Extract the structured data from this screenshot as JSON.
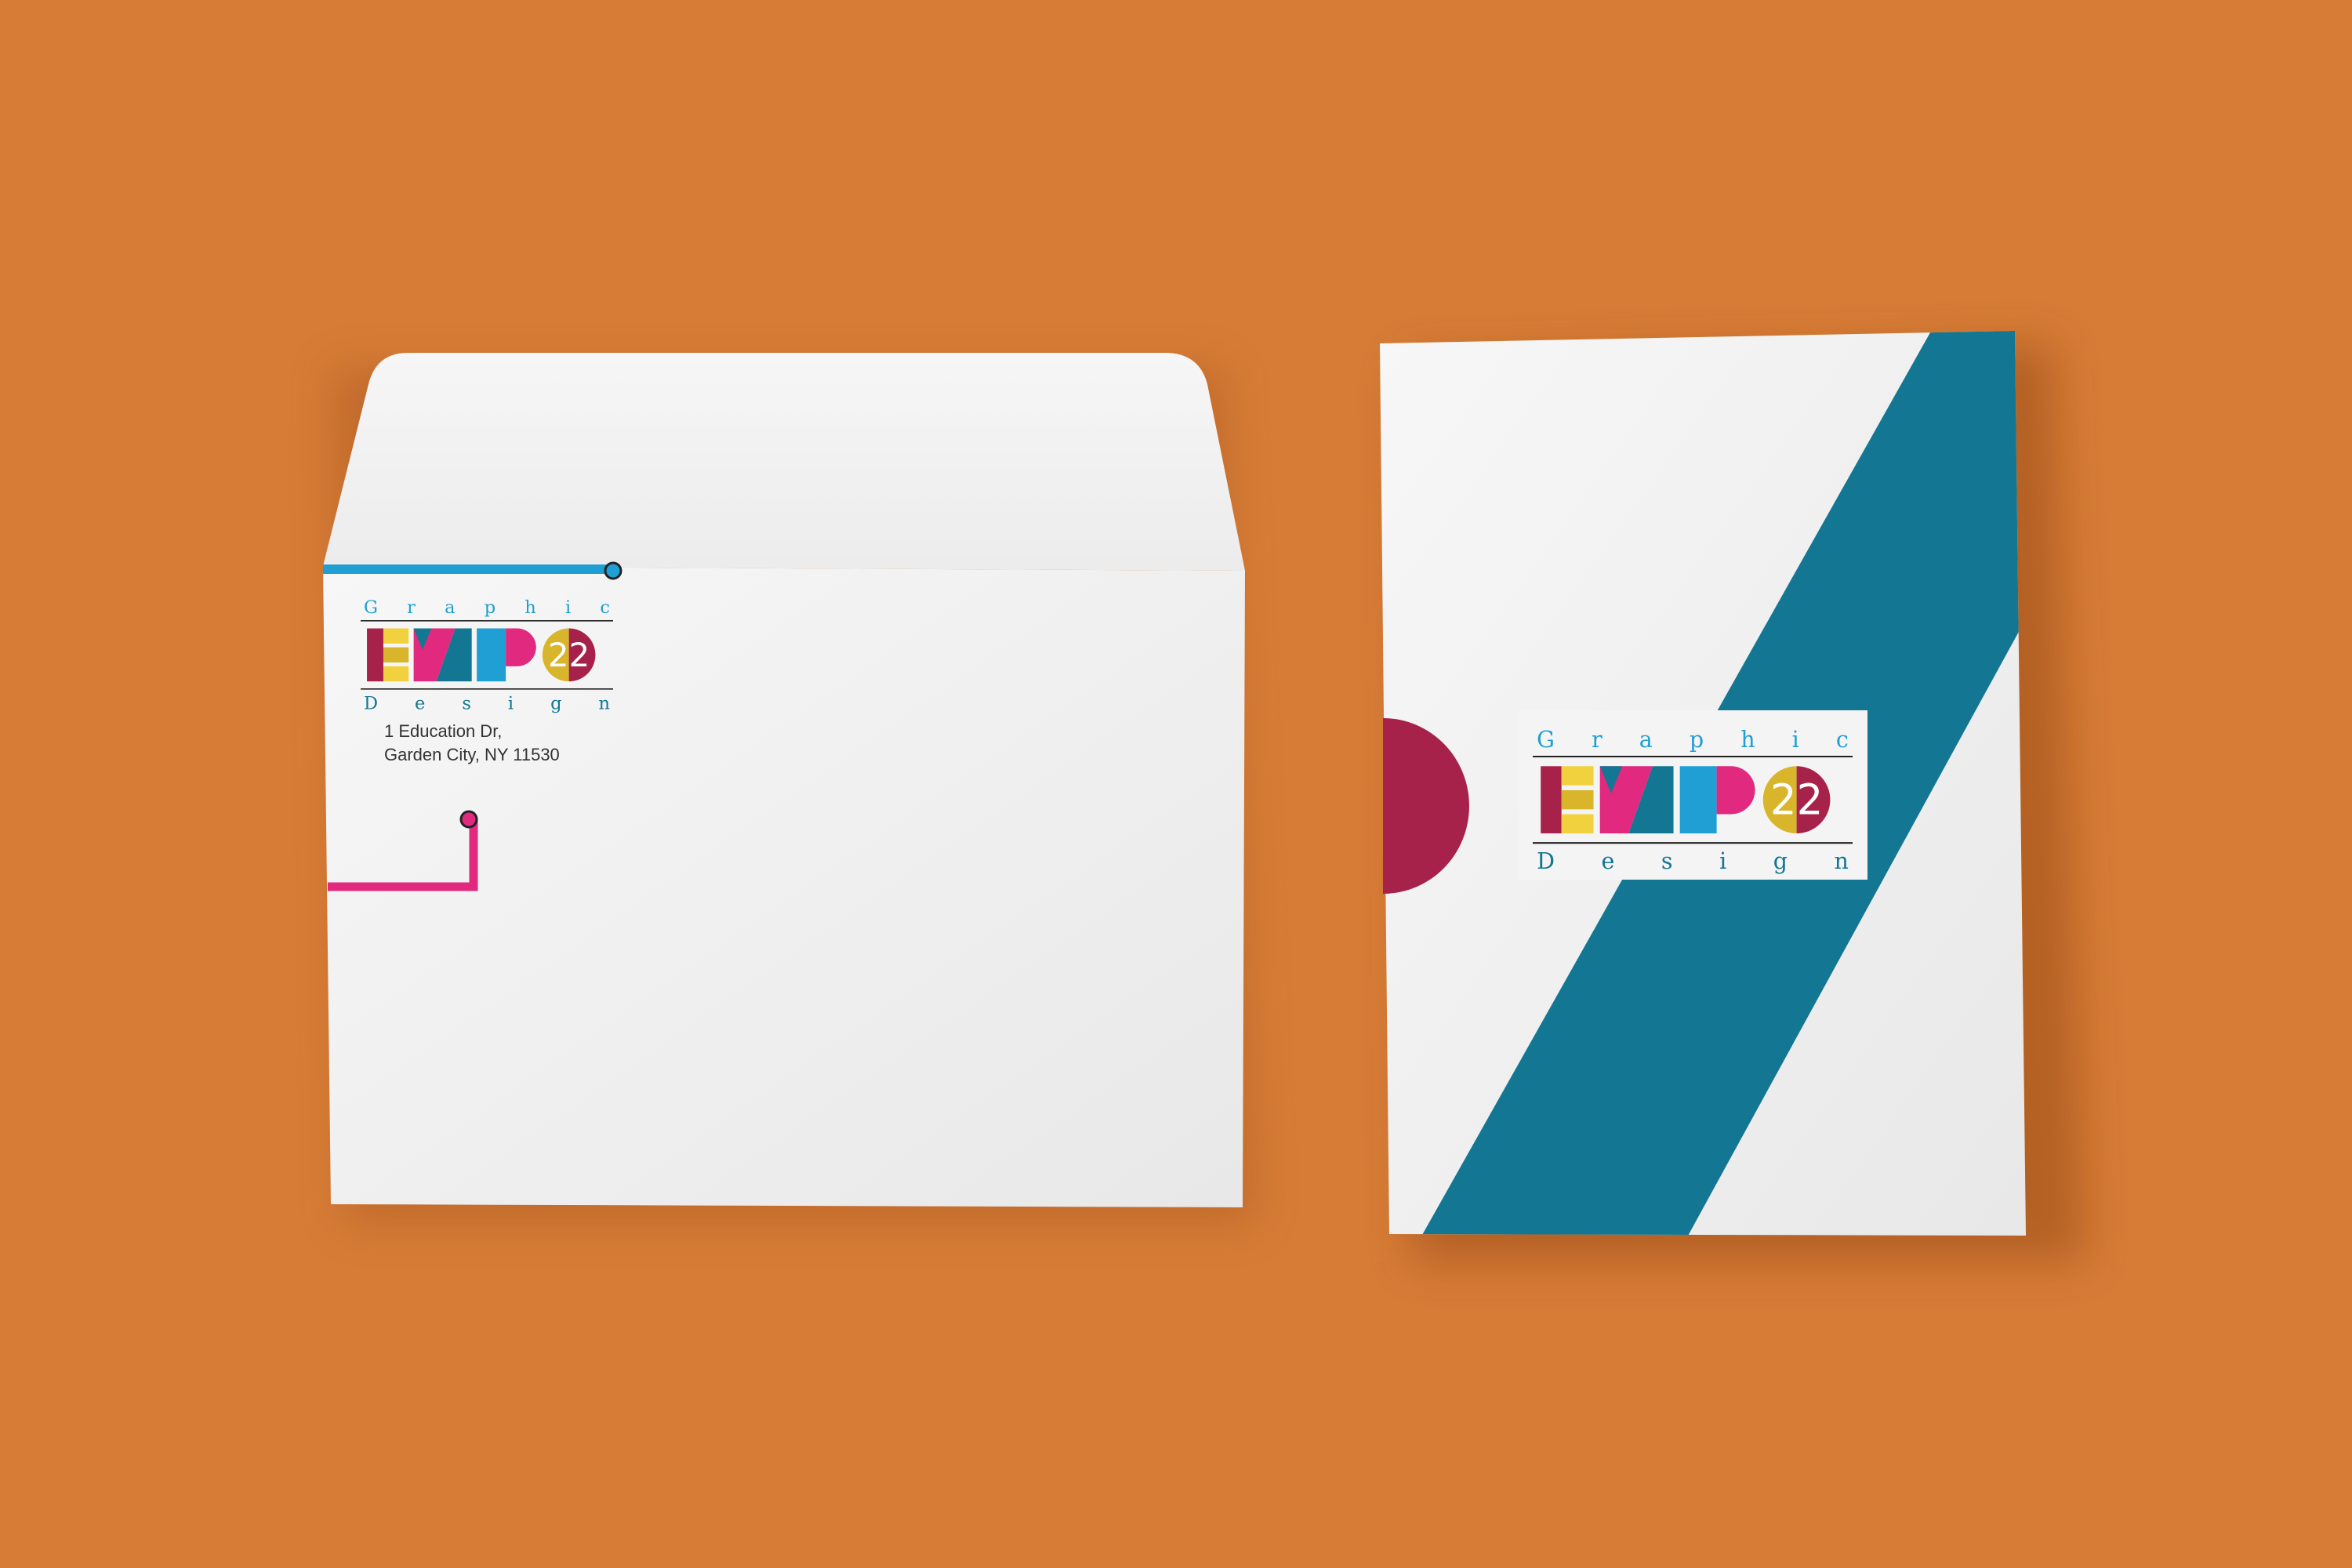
{
  "colors": {
    "background": "#d67c37",
    "paper": "#f1f1f1",
    "teal": "#137692",
    "cyan": "#1f9fd4",
    "magenta": "#e0297f",
    "crimson": "#a7224b",
    "gold": "#d8b52a",
    "yellow": "#f1d23e"
  },
  "logo": {
    "word_top": "Graphic",
    "letters": [
      "E",
      "X",
      "P"
    ],
    "number": "22",
    "word_bottom": "Design"
  },
  "envelope": {
    "address_line1": "1 Education Dr,",
    "address_line2": "Garden City, NY 11530"
  }
}
